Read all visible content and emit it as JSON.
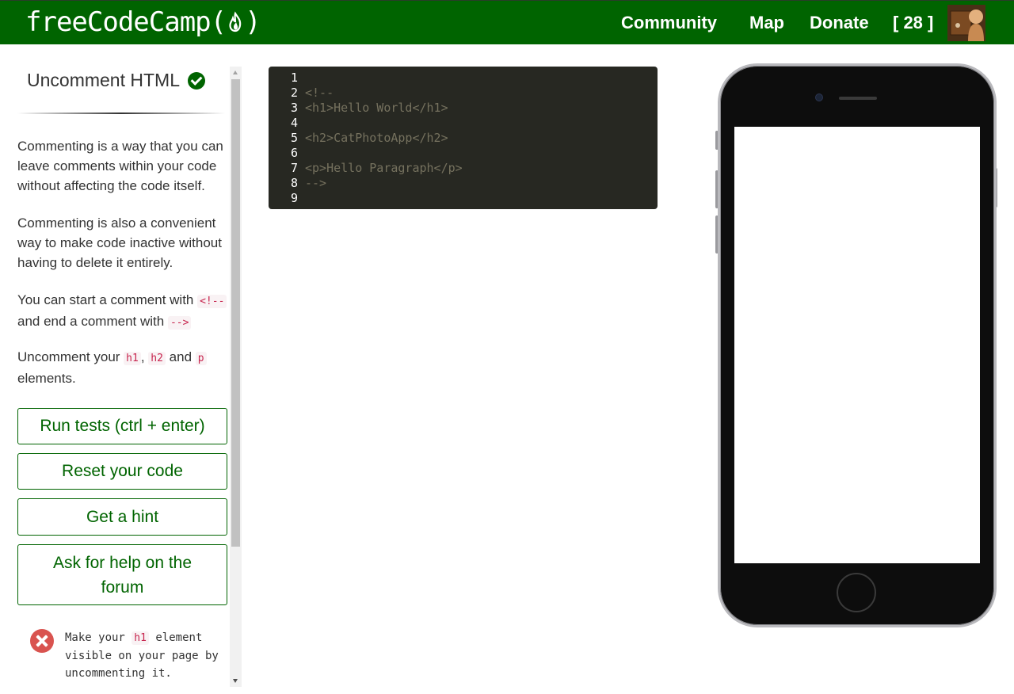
{
  "navbar": {
    "logo_left": "freeCodeCamp(",
    "logo_right": ")",
    "links": {
      "community": "Community",
      "map": "Map",
      "donate": "Donate"
    },
    "points": "[ 28 ]"
  },
  "challenge": {
    "title": "Uncomment HTML",
    "paragraph1": "Commenting is a way that you can leave comments within your code without affecting the code itself.",
    "paragraph2": "Commenting is also a convenient way to make code inactive without having to delete it entirely.",
    "paragraph3": {
      "before": "You can start a comment with ",
      "code1": "<!--",
      "middle": " and end a comment with ",
      "code2": "-->"
    },
    "paragraph4": {
      "before": "Uncomment your ",
      "code1": "h1",
      "sep1": ", ",
      "code2": "h2",
      "sep2": " and ",
      "code3": "p",
      "after": " elements."
    }
  },
  "buttons": {
    "run_tests": "Run tests (ctrl + enter)",
    "reset": "Reset your code",
    "hint": "Get a hint",
    "help": "Ask for help on the forum"
  },
  "test": {
    "before": "Make your ",
    "code": "h1",
    "after": " element visible on your page by uncommenting it."
  },
  "editor": {
    "lines": [
      {
        "num": "1",
        "text": ""
      },
      {
        "num": "2",
        "text": "<!--"
      },
      {
        "num": "3",
        "text": "<h1>Hello World</h1>"
      },
      {
        "num": "4",
        "text": ""
      },
      {
        "num": "5",
        "text": "<h2>CatPhotoApp</h2>"
      },
      {
        "num": "6",
        "text": ""
      },
      {
        "num": "7",
        "text": "<p>Hello Paragraph</p>"
      },
      {
        "num": "8",
        "text": "-->"
      },
      {
        "num": "9",
        "text": ""
      }
    ]
  },
  "colors": {
    "brand_green": "#006400",
    "editor_bg": "#272822",
    "editor_comment": "#75715e",
    "fail_red": "#d9534f",
    "inline_code": "#c7254e"
  }
}
